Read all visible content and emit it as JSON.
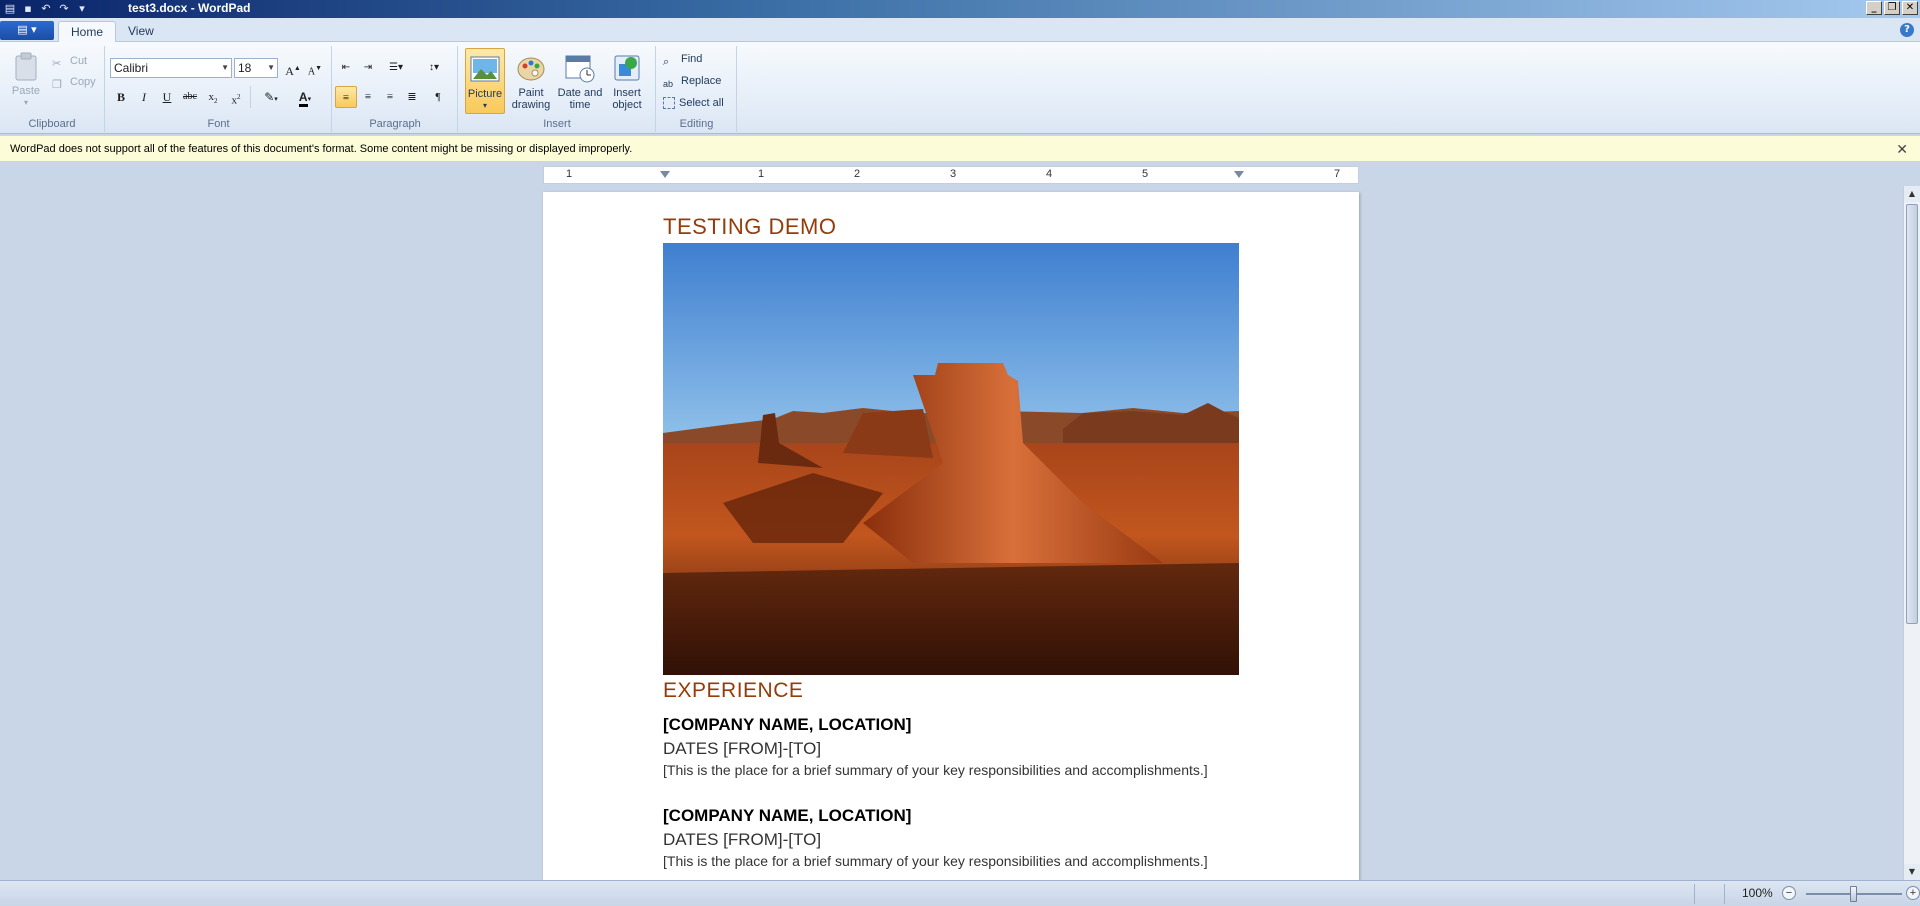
{
  "window": {
    "title": "test3.docx - WordPad"
  },
  "tabs": {
    "home": "Home",
    "view": "View"
  },
  "ribbon": {
    "clipboard": {
      "label": "Clipboard",
      "paste": "Paste",
      "cut": "Cut",
      "copy": "Copy"
    },
    "font": {
      "label": "Font",
      "family": "Calibri",
      "size": "18"
    },
    "paragraph": {
      "label": "Paragraph"
    },
    "insert": {
      "label": "Insert",
      "picture": "Picture",
      "paint_drawing": "Paint drawing",
      "date_time": "Date and time",
      "insert_object": "Insert object"
    },
    "editing": {
      "label": "Editing",
      "find": "Find",
      "replace": "Replace",
      "select_all": "Select all"
    }
  },
  "infobar": {
    "message": "WordPad does not support all of the features of this document's format. Some content might be missing or displayed improperly."
  },
  "ruler": {
    "numbers": [
      "1",
      "1",
      "2",
      "3",
      "4",
      "5",
      "7"
    ]
  },
  "document": {
    "title": "TESTING DEMO",
    "section_heading": "EXPERIENCE",
    "entries": [
      {
        "company": "[COMPANY NAME, LOCATION]",
        "dates": "DATES [FROM]-[TO]",
        "summary": "[This is the place for a brief summary of your key responsibilities and accomplishments.]"
      },
      {
        "company": "[COMPANY NAME, LOCATION]",
        "dates": "DATES [FROM]-[TO]",
        "summary": "[This is the place for a brief summary of your key responsibilities and accomplishments.]"
      }
    ]
  },
  "statusbar": {
    "zoom": "100%",
    "zoom_level_fraction": 0.5
  },
  "colors": {
    "heading": "#943d0a",
    "infobar_bg": "#fcfcd9",
    "selected_button": "#f9c95a"
  }
}
